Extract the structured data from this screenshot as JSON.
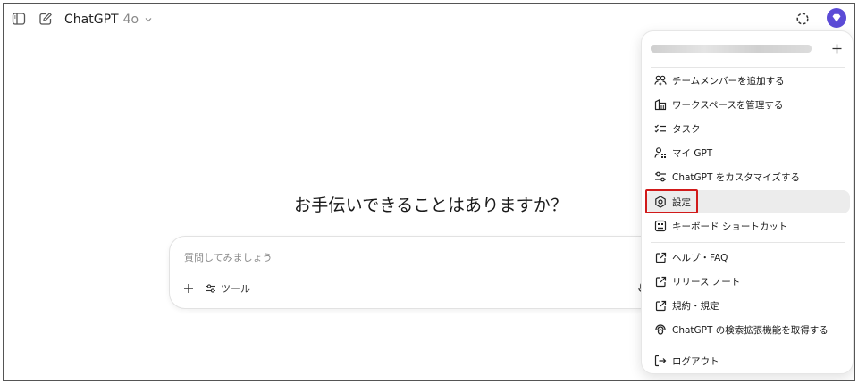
{
  "topbar": {
    "model_name": "ChatGPT",
    "model_version": "4o",
    "icons": [
      "sidebar-toggle-icon",
      "new-chat-icon",
      "chevron-down-icon",
      "temporary-chat-icon",
      "avatar-icon"
    ]
  },
  "main": {
    "headline": "お手伝いできることはありますか？",
    "composer": {
      "placeholder": "質問してみましょう",
      "value": "",
      "tools_label": "ツール"
    }
  },
  "account_menu": {
    "email_obscured": true,
    "items": [
      {
        "label": "チームメンバーを追加する",
        "icon": "people-plus-icon"
      },
      {
        "label": "ワークスペースを管理する",
        "icon": "workspace-icon"
      },
      {
        "label": "タスク",
        "icon": "tasks-icon"
      },
      {
        "label": "マイ GPT",
        "icon": "my-gpt-icon"
      },
      {
        "label": "ChatGPT をカスタマイズする",
        "icon": "customize-icon"
      },
      {
        "label": "設定",
        "icon": "settings-icon",
        "hovered": true,
        "highlighted": true
      },
      {
        "label": "キーボード ショートカット",
        "icon": "keyboard-icon"
      },
      {
        "label": "ヘルプ・FAQ",
        "icon": "external-link-icon"
      },
      {
        "label": "リリース ノート",
        "icon": "external-link-icon"
      },
      {
        "label": "規約・規定",
        "icon": "external-link-icon"
      },
      {
        "label": "ChatGPT の検索拡張機能を取得する",
        "icon": "search-extension-icon"
      },
      {
        "label": "ログアウト",
        "icon": "logout-icon"
      }
    ]
  },
  "colors": {
    "avatar": "#5b4bd6",
    "highlight_border": "#d11a1a",
    "hover_row": "#ececec"
  }
}
